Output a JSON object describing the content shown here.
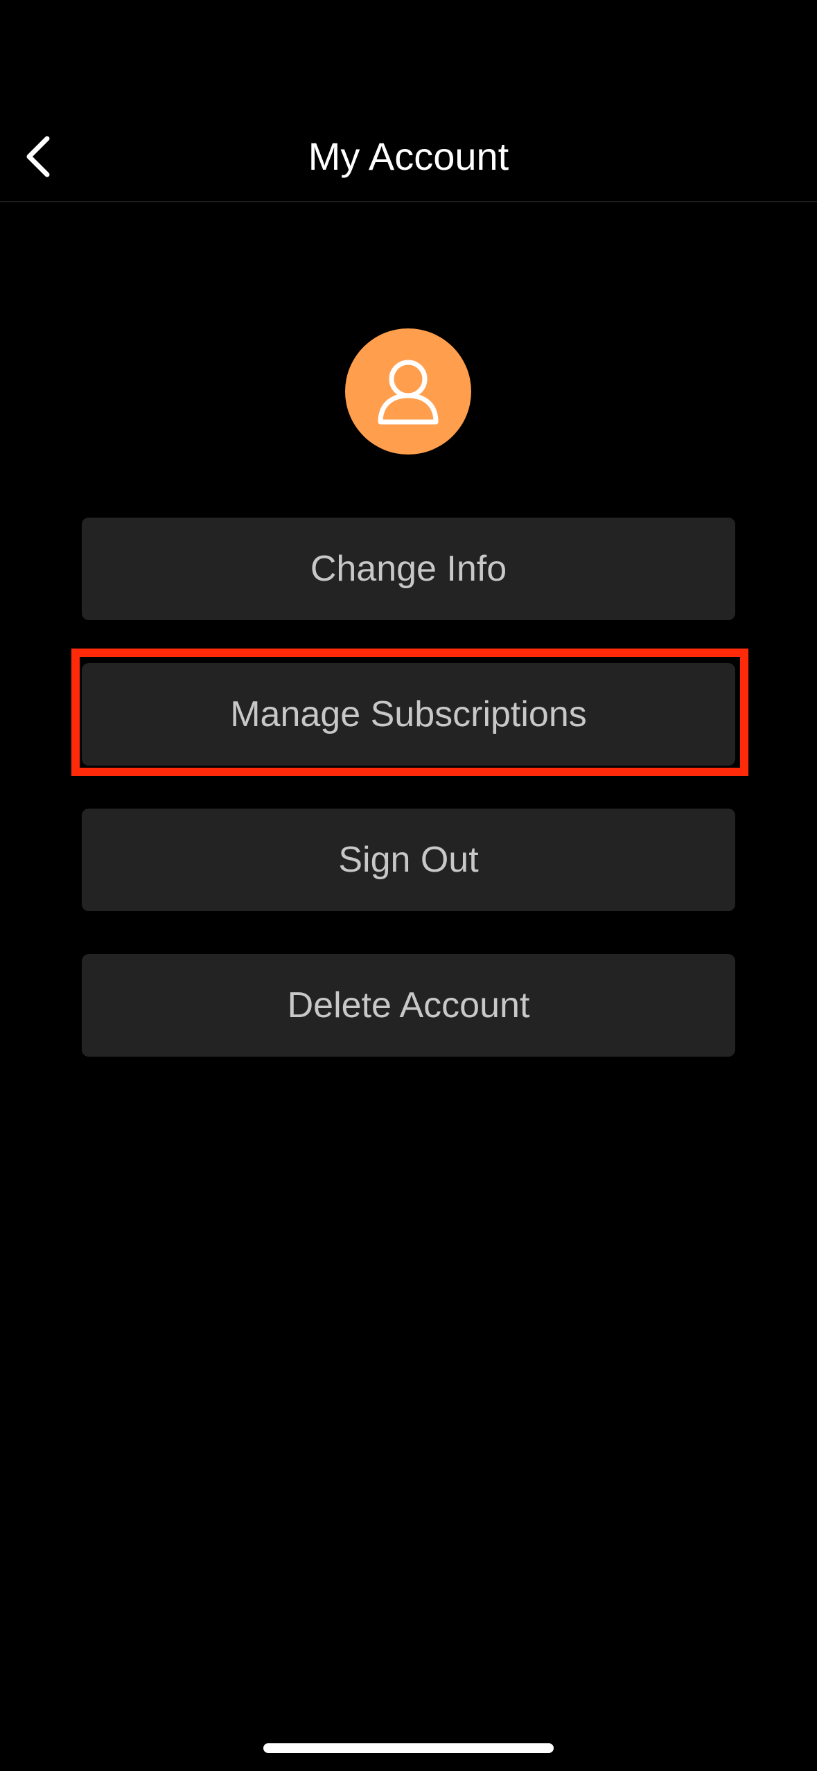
{
  "header": {
    "title": "My Account",
    "back_icon": "chevron-left-icon"
  },
  "avatar": {
    "icon": "user-icon",
    "color": "#ff9f4e"
  },
  "actions": [
    {
      "label": "Change Info"
    },
    {
      "label": "Manage Subscriptions",
      "highlighted": true
    },
    {
      "label": "Sign Out"
    },
    {
      "label": "Delete Account"
    }
  ],
  "colors": {
    "background": "#000000",
    "button_background": "#232323",
    "button_text": "#c8c8c8",
    "highlight_border": "#ff2a0a"
  }
}
